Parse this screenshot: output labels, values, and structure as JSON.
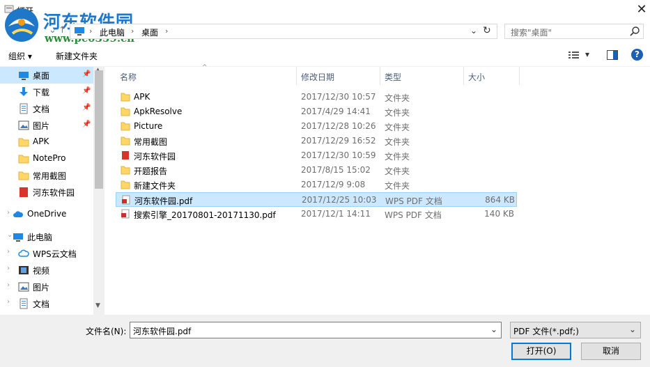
{
  "window": {
    "title": "打开",
    "close_glyph": "✕"
  },
  "watermark": {
    "title": "河东软件园",
    "url": "www.pc0359.cn"
  },
  "nav": {
    "back": "←",
    "forward": "→",
    "up": "↑",
    "recent": "⌄"
  },
  "address": {
    "crumbs": [
      "此电脑",
      "桌面"
    ],
    "sep": "›",
    "dropdown": "⌄",
    "refresh": "↻"
  },
  "search": {
    "placeholder": "搜索\"桌面\""
  },
  "toolbar": {
    "organize": "组织 ▾",
    "new_folder": "新建文件夹",
    "view_menu": "▾",
    "help": "?"
  },
  "sidebar": {
    "items": [
      {
        "label": "桌面",
        "icon": "desktop-icon",
        "pinned": true,
        "selected": true
      },
      {
        "label": "下载",
        "icon": "download-icon",
        "pinned": true
      },
      {
        "label": "文档",
        "icon": "document-icon",
        "pinned": true
      },
      {
        "label": "图片",
        "icon": "pictures-icon",
        "pinned": true
      },
      {
        "label": "APK",
        "icon": "folder-icon"
      },
      {
        "label": "NotePro",
        "icon": "folder-icon"
      },
      {
        "label": "常用截图",
        "icon": "folder-icon"
      },
      {
        "label": "河东软件园",
        "icon": "red-folder-icon"
      },
      {
        "label": "OneDrive",
        "icon": "cloud-icon"
      },
      {
        "label": "此电脑",
        "icon": "computer-icon"
      },
      {
        "label": "WPS云文档",
        "icon": "wps-cloud-icon"
      },
      {
        "label": "视频",
        "icon": "video-icon"
      },
      {
        "label": "图片",
        "icon": "pictures-icon"
      },
      {
        "label": "文档",
        "icon": "document-icon"
      }
    ],
    "pin_glyph": "📌",
    "chevron_right": "›",
    "chevron_down": "⌄"
  },
  "columns": {
    "name": "名称",
    "date": "修改日期",
    "type": "类型",
    "size": "大小",
    "sort_arrow": "^"
  },
  "files": [
    {
      "name": "APK",
      "date": "2017/12/30 10:57",
      "type": "文件夹",
      "size": "",
      "icon": "folder-icon"
    },
    {
      "name": "ApkResolve",
      "date": "2017/4/29 14:41",
      "type": "文件夹",
      "size": "",
      "icon": "folder-icon"
    },
    {
      "name": "Picture",
      "date": "2017/12/28 10:26",
      "type": "文件夹",
      "size": "",
      "icon": "folder-icon"
    },
    {
      "name": "常用截图",
      "date": "2017/12/29 16:52",
      "type": "文件夹",
      "size": "",
      "icon": "folder-icon"
    },
    {
      "name": "河东软件园",
      "date": "2017/12/30 10:59",
      "type": "文件夹",
      "size": "",
      "icon": "red-folder-icon"
    },
    {
      "name": "开题报告",
      "date": "2017/8/15 15:02",
      "type": "文件夹",
      "size": "",
      "icon": "folder-icon"
    },
    {
      "name": "新建文件夹",
      "date": "2017/12/9 9:08",
      "type": "文件夹",
      "size": "",
      "icon": "folder-icon"
    },
    {
      "name": "河东软件园.pdf",
      "date": "2017/12/25 10:03",
      "type": "WPS PDF 文档",
      "size": "864 KB",
      "icon": "pdf-icon",
      "selected": true
    },
    {
      "name": "搜索引擎_20170801-20171130.pdf",
      "date": "2017/12/1 14:11",
      "type": "WPS PDF 文档",
      "size": "140 KB",
      "icon": "pdf-icon"
    }
  ],
  "bottom": {
    "filename_label": "文件名(N):",
    "filename_value": "河东软件园.pdf",
    "filter_value": "PDF 文件(*.pdf;)",
    "dropdown": "⌄",
    "open_label": "打开(O)",
    "cancel_label": "取消"
  },
  "colors": {
    "selection": "#cce8ff",
    "folder": "#ffd766",
    "red_folder": "#d9342b",
    "accent": "#0078d7"
  }
}
